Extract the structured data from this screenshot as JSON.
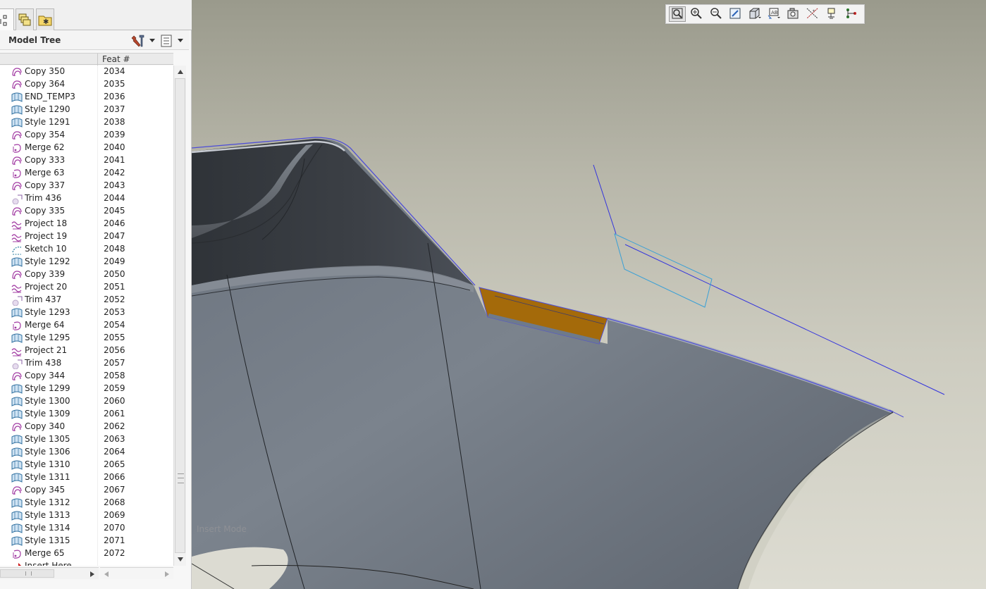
{
  "panel": {
    "tabs": [
      {
        "icon": "model-tree-tab-icon"
      },
      {
        "icon": "layers-tab-icon"
      },
      {
        "icon": "favorites-tab-icon"
      }
    ],
    "title": "Model Tree",
    "column_header": "Feat #",
    "rows": [
      {
        "name": "Copy 350",
        "feat": "2034",
        "icon": "copy"
      },
      {
        "name": "Copy 364",
        "feat": "2035",
        "icon": "copy"
      },
      {
        "name": "END_TEMP3",
        "feat": "2036",
        "icon": "style"
      },
      {
        "name": "Style 1290",
        "feat": "2037",
        "icon": "style"
      },
      {
        "name": "Style 1291",
        "feat": "2038",
        "icon": "style"
      },
      {
        "name": "Copy 354",
        "feat": "2039",
        "icon": "copy"
      },
      {
        "name": "Merge 62",
        "feat": "2040",
        "icon": "merge"
      },
      {
        "name": "Copy 333",
        "feat": "2041",
        "icon": "copy"
      },
      {
        "name": "Merge 63",
        "feat": "2042",
        "icon": "merge"
      },
      {
        "name": "Copy 337",
        "feat": "2043",
        "icon": "copy"
      },
      {
        "name": "Trim 436",
        "feat": "2044",
        "icon": "trim"
      },
      {
        "name": "Copy 335",
        "feat": "2045",
        "icon": "copy"
      },
      {
        "name": "Project 18",
        "feat": "2046",
        "icon": "project"
      },
      {
        "name": "Project 19",
        "feat": "2047",
        "icon": "project"
      },
      {
        "name": "Sketch 10",
        "feat": "2048",
        "icon": "sketch"
      },
      {
        "name": "Style 1292",
        "feat": "2049",
        "icon": "style"
      },
      {
        "name": "Copy 339",
        "feat": "2050",
        "icon": "copy"
      },
      {
        "name": "Project 20",
        "feat": "2051",
        "icon": "project"
      },
      {
        "name": "Trim 437",
        "feat": "2052",
        "icon": "trim"
      },
      {
        "name": "Style 1293",
        "feat": "2053",
        "icon": "style"
      },
      {
        "name": "Merge 64",
        "feat": "2054",
        "icon": "merge"
      },
      {
        "name": "Style 1295",
        "feat": "2055",
        "icon": "style"
      },
      {
        "name": "Project 21",
        "feat": "2056",
        "icon": "project"
      },
      {
        "name": "Trim 438",
        "feat": "2057",
        "icon": "trim"
      },
      {
        "name": "Copy 344",
        "feat": "2058",
        "icon": "copy"
      },
      {
        "name": "Style 1299",
        "feat": "2059",
        "icon": "style"
      },
      {
        "name": "Style 1300",
        "feat": "2060",
        "icon": "style"
      },
      {
        "name": "Style 1309",
        "feat": "2061",
        "icon": "style"
      },
      {
        "name": "Copy 340",
        "feat": "2062",
        "icon": "copy"
      },
      {
        "name": "Style 1305",
        "feat": "2063",
        "icon": "style"
      },
      {
        "name": "Style 1306",
        "feat": "2064",
        "icon": "style"
      },
      {
        "name": "Style 1310",
        "feat": "2065",
        "icon": "style"
      },
      {
        "name": "Style 1311",
        "feat": "2066",
        "icon": "style"
      },
      {
        "name": "Copy 345",
        "feat": "2067",
        "icon": "copy"
      },
      {
        "name": "Style 1312",
        "feat": "2068",
        "icon": "style"
      },
      {
        "name": "Style 1313",
        "feat": "2069",
        "icon": "style"
      },
      {
        "name": "Style 1314",
        "feat": "2070",
        "icon": "style"
      },
      {
        "name": "Style 1315",
        "feat": "2071",
        "icon": "style"
      },
      {
        "name": "Merge 65",
        "feat": "2072",
        "icon": "merge"
      },
      {
        "name": "Insert Here",
        "feat": "",
        "icon": "insert"
      }
    ]
  },
  "viewport": {
    "mode_label": "Insert Mode",
    "toolbar": [
      "refit-icon",
      "zoom-in-icon",
      "zoom-out-icon",
      "repaint-icon",
      "display-style-icon",
      "saved-views-icon",
      "view-manager-icon",
      "datum-display-icon",
      "annotation-display-icon",
      "spin-center-icon"
    ]
  },
  "colors": {
    "copy": "#a23ca3",
    "merge": "#a23ca3",
    "project": "#a23ca3",
    "style": "#2f6f9f",
    "trim": "#b9a8c9",
    "sketch": "#2c7fa0",
    "insert": "#cc1111",
    "highlight_surface": "#a46a0a",
    "surface": "#6a717a",
    "edge": "#4f4fd6"
  }
}
